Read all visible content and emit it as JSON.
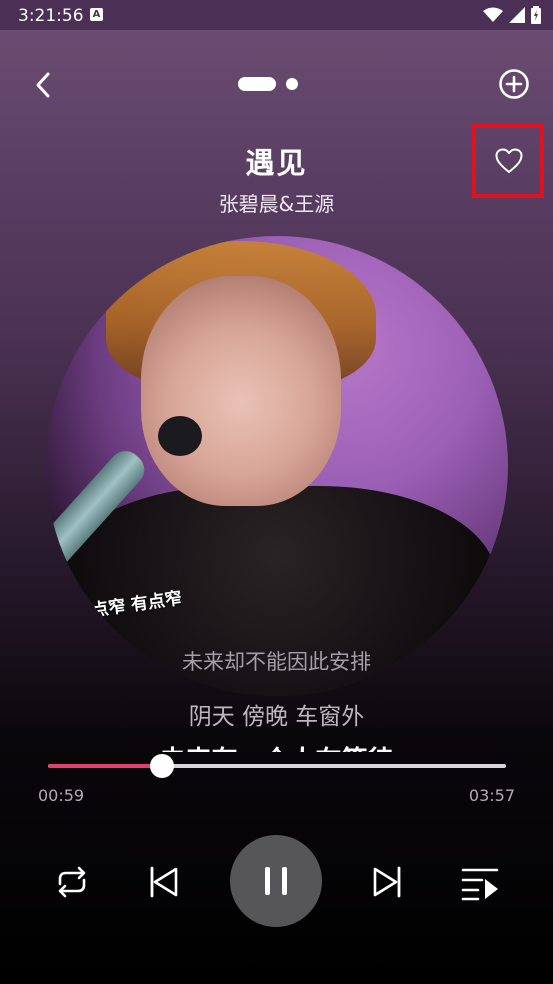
{
  "status_bar": {
    "time": "3:21:56",
    "notification_icon": "A"
  },
  "header": {
    "page_indicator": {
      "count": 2,
      "active": 0
    }
  },
  "song": {
    "title": "遇见",
    "artist": "张碧晨&王源"
  },
  "cover": {
    "subtitle_text": "有点窄 有点窄"
  },
  "lyrics": {
    "current": "未来却不能因此安排",
    "next": "阴天 傍晚 车窗外",
    "following": "未来有一个人在等待"
  },
  "player": {
    "current_time": "00:59",
    "total_time": "03:57",
    "progress_fraction": 0.2489,
    "progress_color": "#e0426e",
    "is_playing": true
  },
  "icons": {
    "back": "chevron-left-icon",
    "add": "circle-plus-icon",
    "favorite": "heart-outline-icon",
    "repeat": "repeat-icon",
    "previous": "skip-previous-icon",
    "pause": "pause-icon",
    "next": "skip-next-icon",
    "playlist": "playlist-icon"
  },
  "highlight_color": "#e0121d"
}
